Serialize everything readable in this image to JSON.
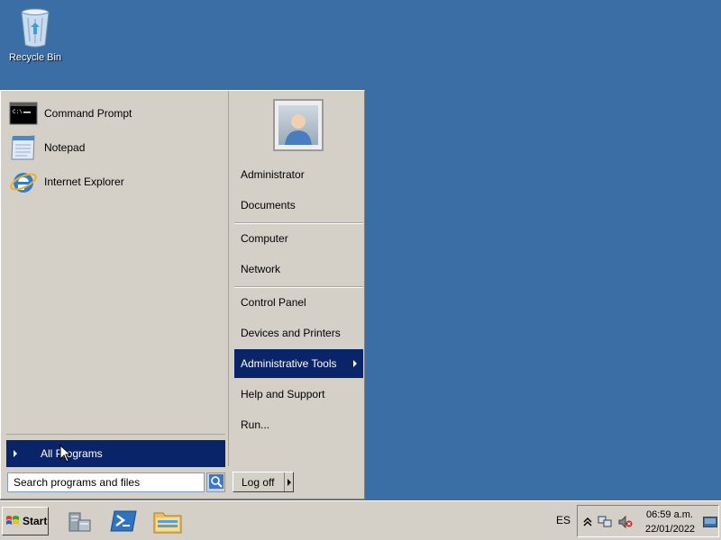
{
  "desktop": {
    "recycle_bin_label": "Recycle Bin"
  },
  "start_menu": {
    "programs": [
      {
        "label": "Command Prompt",
        "icon": "command-prompt-icon"
      },
      {
        "label": "Notepad",
        "icon": "notepad-icon"
      },
      {
        "label": "Internet Explorer",
        "icon": "internet-explorer-icon"
      }
    ],
    "all_programs_label": "All Programs",
    "search_placeholder": "Search programs and files",
    "right_items": [
      {
        "label": "Administrator"
      },
      {
        "label": "Documents"
      },
      {
        "label": "Computer"
      },
      {
        "label": "Network"
      },
      {
        "label": "Control Panel"
      },
      {
        "label": "Devices and Printers"
      },
      {
        "label": "Administrative Tools",
        "highlighted": true,
        "has_submenu": true
      },
      {
        "label": "Help and Support"
      },
      {
        "label": "Run..."
      }
    ],
    "logoff_label": "Log off"
  },
  "taskbar": {
    "start_label": "Start",
    "pinned": [
      "server-manager-icon",
      "powershell-icon",
      "explorer-folder-icon"
    ],
    "language": "ES",
    "time": "06:59 a.m.",
    "date": "22/01/2022"
  },
  "colors": {
    "desktop": "#3a6ea5",
    "menu_bg": "#d4d0c8",
    "highlight": "#0a246a"
  }
}
